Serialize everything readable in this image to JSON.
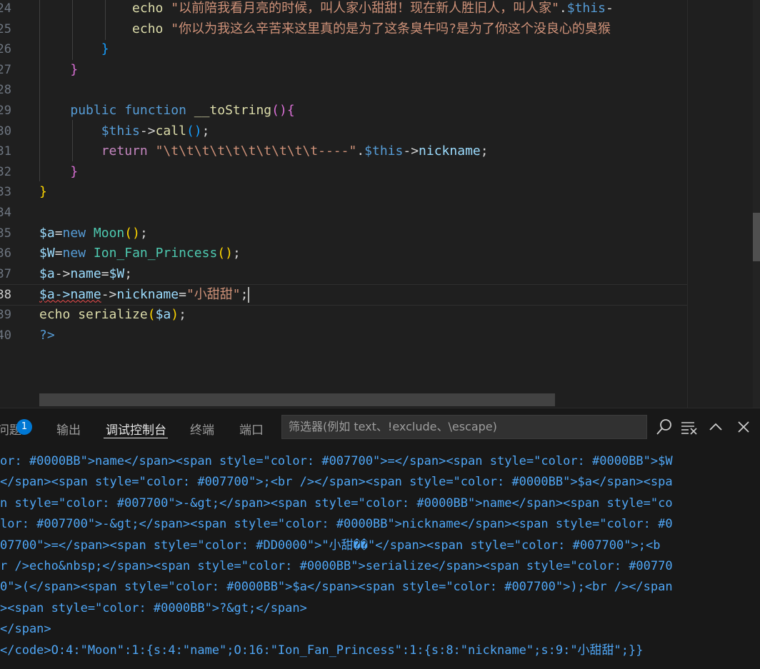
{
  "editor": {
    "lines": [
      {
        "num": "24",
        "segments": [
          {
            "t": "            ",
            "c": "plain"
          },
          {
            "t": "echo ",
            "c": "fn"
          },
          {
            "t": "\"以前陪我看月亮的时候，叫人家小甜甜！现在新人胜旧人，叫人家\"",
            "c": "str"
          },
          {
            "t": ".",
            "c": "plain"
          },
          {
            "t": "$this",
            "c": "kw"
          },
          {
            "t": "-",
            "c": "plain"
          }
        ]
      },
      {
        "num": "25",
        "segments": [
          {
            "t": "            ",
            "c": "plain"
          },
          {
            "t": "echo ",
            "c": "fn"
          },
          {
            "t": "\"你以为我这么辛苦来这里真的是为了这条臭牛吗?是为了你这个没良心的臭猴",
            "c": "str"
          }
        ]
      },
      {
        "num": "26",
        "segments": [
          {
            "t": "        ",
            "c": "plain"
          },
          {
            "t": "}",
            "c": "br3"
          }
        ]
      },
      {
        "num": "27",
        "segments": [
          {
            "t": "    ",
            "c": "plain"
          },
          {
            "t": "}",
            "c": "br2"
          }
        ]
      },
      {
        "num": "28",
        "segments": []
      },
      {
        "num": "29",
        "segments": [
          {
            "t": "    ",
            "c": "plain"
          },
          {
            "t": "public function ",
            "c": "kw"
          },
          {
            "t": "__toString",
            "c": "fn"
          },
          {
            "t": "()",
            "c": "br2"
          },
          {
            "t": "{",
            "c": "br2"
          }
        ]
      },
      {
        "num": "30",
        "segments": [
          {
            "t": "        ",
            "c": "plain"
          },
          {
            "t": "$this",
            "c": "kw"
          },
          {
            "t": "->",
            "c": "plain"
          },
          {
            "t": "call",
            "c": "fn"
          },
          {
            "t": "()",
            "c": "br3"
          },
          {
            "t": ";",
            "c": "plain"
          }
        ]
      },
      {
        "num": "31",
        "segments": [
          {
            "t": "        ",
            "c": "plain"
          },
          {
            "t": "return ",
            "c": "ctl"
          },
          {
            "t": "\"\\t\\t\\t\\t\\t\\t\\t\\t\\t\\t----\"",
            "c": "str"
          },
          {
            "t": ".",
            "c": "plain"
          },
          {
            "t": "$this",
            "c": "kw"
          },
          {
            "t": "->",
            "c": "plain"
          },
          {
            "t": "nickname",
            "c": "var"
          },
          {
            "t": ";",
            "c": "plain"
          }
        ]
      },
      {
        "num": "32",
        "segments": [
          {
            "t": "    ",
            "c": "plain"
          },
          {
            "t": "}",
            "c": "br2"
          }
        ]
      },
      {
        "num": "33",
        "segments": [
          {
            "t": "}",
            "c": "br1"
          }
        ]
      },
      {
        "num": "34",
        "segments": []
      },
      {
        "num": "35",
        "segments": [
          {
            "t": "$a",
            "c": "var"
          },
          {
            "t": "=",
            "c": "plain"
          },
          {
            "t": "new ",
            "c": "kw"
          },
          {
            "t": "Moon",
            "c": "cls"
          },
          {
            "t": "()",
            "c": "br1"
          },
          {
            "t": ";",
            "c": "plain"
          }
        ]
      },
      {
        "num": "36",
        "segments": [
          {
            "t": "$W",
            "c": "var"
          },
          {
            "t": "=",
            "c": "plain"
          },
          {
            "t": "new ",
            "c": "kw"
          },
          {
            "t": "Ion_Fan_Princess",
            "c": "cls"
          },
          {
            "t": "()",
            "c": "br1"
          },
          {
            "t": ";",
            "c": "plain"
          }
        ]
      },
      {
        "num": "37",
        "segments": [
          {
            "t": "$a",
            "c": "var"
          },
          {
            "t": "->",
            "c": "plain"
          },
          {
            "t": "name",
            "c": "var"
          },
          {
            "t": "=",
            "c": "plain"
          },
          {
            "t": "$W",
            "c": "var"
          },
          {
            "t": ";",
            "c": "plain"
          }
        ]
      },
      {
        "num": "38",
        "segments": [
          {
            "t": "$a->name",
            "c": "var squig"
          },
          {
            "t": "->",
            "c": "plain"
          },
          {
            "t": "nickname",
            "c": "var"
          },
          {
            "t": "=",
            "c": "plain"
          },
          {
            "t": "\"小甜甜\"",
            "c": "str"
          },
          {
            "t": ";",
            "c": "plain"
          }
        ],
        "active": true
      },
      {
        "num": "39",
        "segments": [
          {
            "t": "echo ",
            "c": "fn"
          },
          {
            "t": "serialize",
            "c": "fn"
          },
          {
            "t": "(",
            "c": "br1"
          },
          {
            "t": "$a",
            "c": "var"
          },
          {
            "t": ")",
            "c": "br1"
          },
          {
            "t": ";",
            "c": "plain"
          }
        ]
      },
      {
        "num": "40",
        "segments": [
          {
            "t": "?>",
            "c": "kw"
          }
        ]
      }
    ]
  },
  "panel": {
    "tabs": [
      {
        "label": "问题",
        "badge": "1"
      },
      {
        "label": "输出"
      },
      {
        "label": "调试控制台",
        "active": true
      },
      {
        "label": "终端"
      },
      {
        "label": "端口"
      }
    ],
    "filter_placeholder": "筛选器(例如 text、!exclude、\\escape)",
    "output_lines": [
      "or: #0000BB\">name</span><span style=\"color: #007700\">=</span><span style=\"color: #0000BB\">$W",
      "</span><span style=\"color: #007700\">;<br /></span><span style=\"color: #0000BB\">$a</span><spa",
      "n style=\"color: #007700\">-&gt;</span><span style=\"color: #0000BB\">name</span><span style=\"co",
      "lor: #007700\">-&gt;</span><span style=\"color: #0000BB\">nickname</span><span style=\"color: #0",
      "07700\">=</span><span style=\"color: #DD0000\">\"小甜��\"</span><span style=\"color: #007700\">;<b",
      "r />echo&nbsp;</span><span style=\"color: #0000BB\">serialize</span><span style=\"color: #00770",
      "0\">(</span><span style=\"color: #0000BB\">$a</span><span style=\"color: #007700\">);<br /></span",
      "><span style=\"color: #0000BB\">?&gt;</span>",
      "</span>",
      "</code>O:4:\"Moon\":1:{s:4:\"name\";O:16:\"Ion_Fan_Princess\":1:{s:8:\"nickname\";s:9:\"小甜甜\";}}"
    ]
  }
}
